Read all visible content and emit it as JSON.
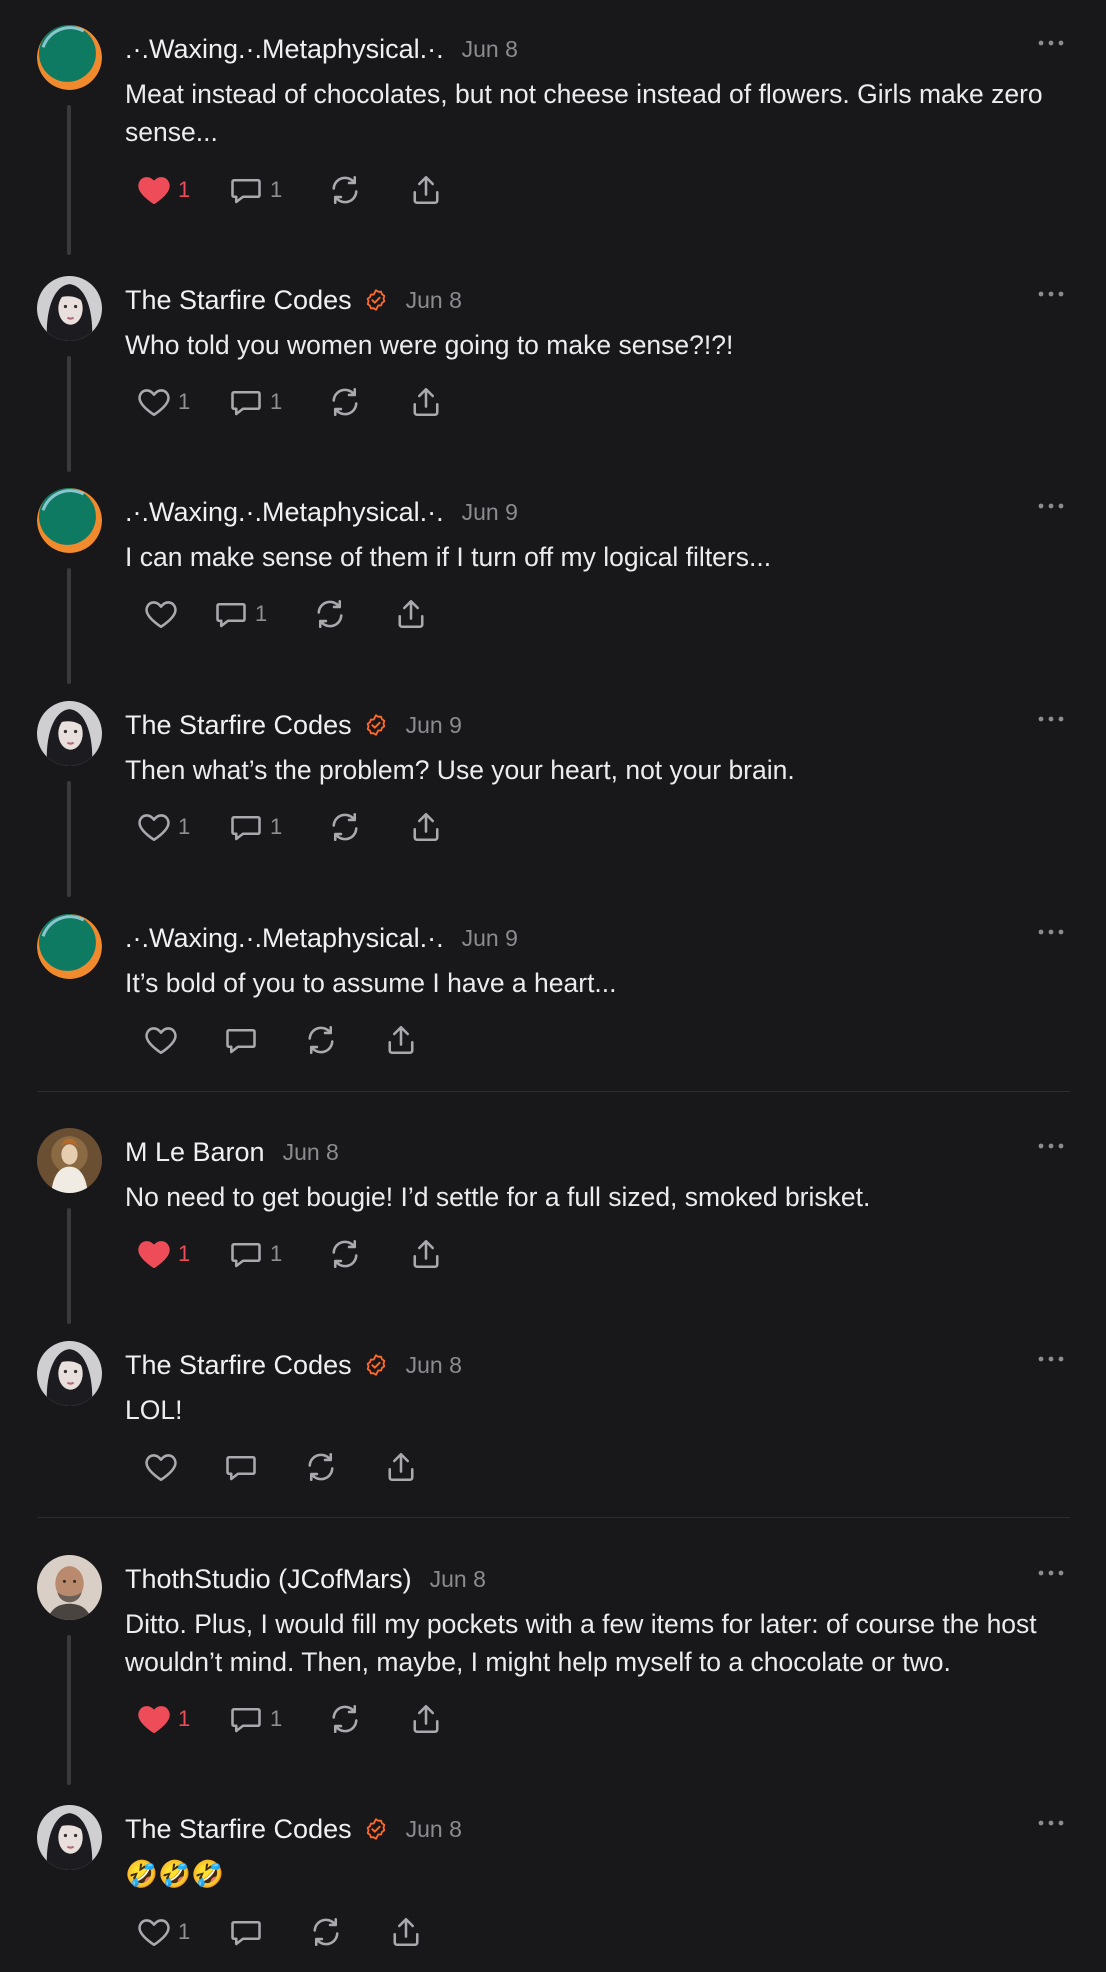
{
  "colors": {
    "background": "#18181b",
    "accent_verified": "#ff6a2b",
    "like_red": "#ef4c5a",
    "muted": "#8b8b90"
  },
  "comments": [
    {
      "author": ".·.Waxing.·.Metaphysical.·.",
      "date": "Jun 8",
      "verified": false,
      "text": "Meat instead of chocolates, but not cheese instead of flowers. Girls make zero sense...",
      "liked": true,
      "likes": "1",
      "replies": "1",
      "avatar": "green-orange-circle"
    },
    {
      "author": "The Starfire Codes",
      "date": "Jun 8",
      "verified": true,
      "text": "Who told you women were going to make sense?!?!",
      "liked": false,
      "likes": "1",
      "replies": "1",
      "avatar": "woman-portrait"
    },
    {
      "author": ".·.Waxing.·.Metaphysical.·.",
      "date": "Jun 9",
      "verified": false,
      "text": "I can make sense of them if I turn off my logical filters...",
      "liked": false,
      "likes": "",
      "replies": "1",
      "avatar": "green-orange-circle"
    },
    {
      "author": "The Starfire Codes",
      "date": "Jun 9",
      "verified": true,
      "text": "Then what’s the problem? Use your heart, not your brain.",
      "liked": false,
      "likes": "1",
      "replies": "1",
      "avatar": "woman-portrait"
    },
    {
      "author": ".·.Waxing.·.Metaphysical.·.",
      "date": "Jun 9",
      "verified": false,
      "text": "It’s bold of you to assume I have a heart...",
      "liked": false,
      "likes": "",
      "replies": "",
      "avatar": "green-orange-circle"
    },
    {
      "author": "M Le Baron",
      "date": "Jun 8",
      "verified": false,
      "text": "No need to get bougie! I’d settle for a full sized, smoked brisket.",
      "liked": true,
      "likes": "1",
      "replies": "1",
      "avatar": "painting-portrait"
    },
    {
      "author": "The Starfire Codes",
      "date": "Jun 8",
      "verified": true,
      "text": "LOL!",
      "liked": false,
      "likes": "",
      "replies": "",
      "avatar": "woman-portrait"
    },
    {
      "author": "ThothStudio (JCofMars)",
      "date": "Jun 8",
      "verified": false,
      "text": "Ditto. Plus, I would fill my pockets with a few items for later: of course the host wouldn’t mind. Then, maybe, I might help myself to a chocolate or two.",
      "liked": true,
      "likes": "1",
      "replies": "1",
      "avatar": "bald-man-portrait"
    },
    {
      "author": "The Starfire Codes",
      "date": "Jun 8",
      "verified": true,
      "text": "🤣🤣🤣",
      "liked": false,
      "likes": "1",
      "replies": "",
      "avatar": "woman-portrait"
    }
  ]
}
